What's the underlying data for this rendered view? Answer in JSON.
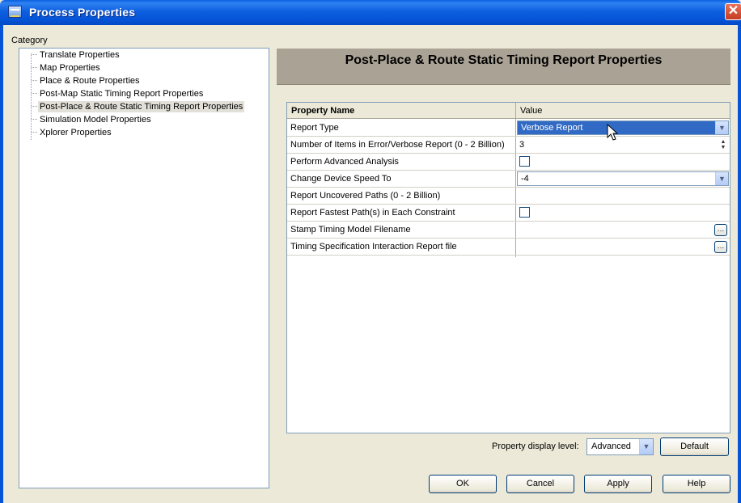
{
  "window": {
    "title": "Process Properties",
    "close_glyph": "✕"
  },
  "category": {
    "label": "Category",
    "items": [
      {
        "label": "Translate Properties"
      },
      {
        "label": "Map Properties"
      },
      {
        "label": "Place & Route Properties"
      },
      {
        "label": "Post-Map Static Timing Report Properties"
      },
      {
        "label": "Post-Place & Route Static Timing Report Properties",
        "selected": true
      },
      {
        "label": "Simulation Model Properties"
      },
      {
        "label": "Xplorer Properties"
      }
    ]
  },
  "panel": {
    "header": "Post-Place & Route Static Timing Report Properties",
    "columns": {
      "name": "Property Name",
      "value": "Value"
    },
    "rows": [
      {
        "name": "Report Type",
        "value": "Verbose Report",
        "control": "dropdown-selected"
      },
      {
        "name": "Number of Items in Error/Verbose Report (0 - 2 Billion)",
        "value": "3",
        "control": "spinner"
      },
      {
        "name": "Perform Advanced Analysis",
        "value": "",
        "control": "checkbox"
      },
      {
        "name": "Change Device Speed To",
        "value": "-4",
        "control": "dropdown"
      },
      {
        "name": "Report Uncovered Paths (0 - 2 Billion)",
        "value": "",
        "control": "text"
      },
      {
        "name": "Report Fastest Path(s) in Each Constraint",
        "value": "",
        "control": "checkbox"
      },
      {
        "name": "Stamp Timing Model Filename",
        "value": "",
        "control": "browse"
      },
      {
        "name": "Timing Specification Interaction Report file",
        "value": "",
        "control": "browse"
      }
    ],
    "dropdown_glyph": "▼",
    "spin_glyphs": {
      "up": "▲",
      "down": "▼"
    },
    "browse_glyph": "…"
  },
  "footer": {
    "display_level_label": "Property display level:",
    "display_level_value": "Advanced",
    "default_button": "Default"
  },
  "buttons": {
    "ok": "OK",
    "cancel": "Cancel",
    "apply": "Apply",
    "help": "Help"
  },
  "colors": {
    "titlebar": "#0553d6",
    "selection": "#316ac5",
    "header_panel": "#aaa395",
    "dialog_bg": "#ece9d8"
  }
}
